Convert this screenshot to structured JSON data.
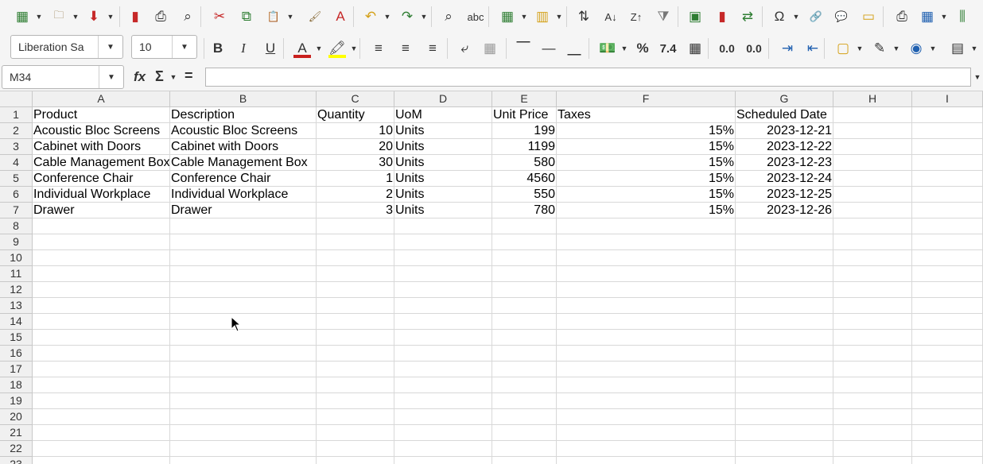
{
  "toolbar1": {
    "icons": [
      "new-spreadsheet-icon",
      "open-folder-icon",
      "save-icon",
      "export-pdf-icon",
      "print-icon",
      "print-preview-icon",
      "cut-icon",
      "copy-icon",
      "paste-icon",
      "clone-formatting-icon",
      "clear-formatting-icon",
      "undo-icon",
      "redo-icon",
      "find-replace-icon",
      "spellcheck-icon",
      "insert-row-icon",
      "insert-column-icon",
      "sort-icon",
      "sort-ascending-icon",
      "sort-descending-icon",
      "autofilter-icon",
      "insert-image-icon",
      "insert-chart-icon",
      "pivot-table-icon",
      "special-character-icon",
      "hyperlink-icon",
      "comment-icon",
      "header-footer-icon",
      "print-area-icon",
      "freeze-rows-icon",
      "split-window-icon"
    ]
  },
  "format": {
    "font_name": "Liberation Sa",
    "font_size": "10",
    "number_format_percent": "%",
    "number_format_number": "7.4",
    "add_decimal": "0.0",
    "remove_decimal": "0.0"
  },
  "colors": {
    "font_color": "#c9211e",
    "highlight_color": "#ffff00",
    "toolbar_bg": "#f5f5f5"
  },
  "formula_bar": {
    "name_box": "M34",
    "fx_label": "fx",
    "sum_label": "Σ",
    "equals_label": "=",
    "formula": ""
  },
  "sheet": {
    "columns": [
      "A",
      "B",
      "C",
      "D",
      "E",
      "F",
      "G",
      "H",
      "I"
    ],
    "rows": [
      "1",
      "2",
      "3",
      "4",
      "5",
      "6",
      "7",
      "8",
      "9",
      "10",
      "11",
      "12",
      "13",
      "14",
      "15",
      "16",
      "17",
      "18",
      "19",
      "20",
      "21",
      "22",
      "23"
    ],
    "header": [
      "Product",
      "Description",
      "Quantity",
      "UoM",
      "Unit Price",
      "Taxes",
      "Scheduled Date"
    ],
    "data": [
      [
        "Acoustic Bloc Screens",
        "Acoustic Bloc Screens",
        "10",
        "Units",
        "199",
        "15%",
        "2023-12-21"
      ],
      [
        "Cabinet with Doors",
        "Cabinet with Doors",
        "20",
        "Units",
        "1199",
        "15%",
        "2023-12-22"
      ],
      [
        "Cable Management Box",
        "Cable Management Box",
        "30",
        "Units",
        "580",
        "15%",
        "2023-12-23"
      ],
      [
        "Conference Chair",
        "Conference Chair",
        "1",
        "Units",
        "4560",
        "15%",
        "2023-12-24"
      ],
      [
        "Individual Workplace",
        "Individual Workplace",
        "2",
        "Units",
        "550",
        "15%",
        "2023-12-25"
      ],
      [
        "Drawer",
        "Drawer",
        "3",
        "Units",
        "780",
        "15%",
        "2023-12-26"
      ]
    ]
  }
}
